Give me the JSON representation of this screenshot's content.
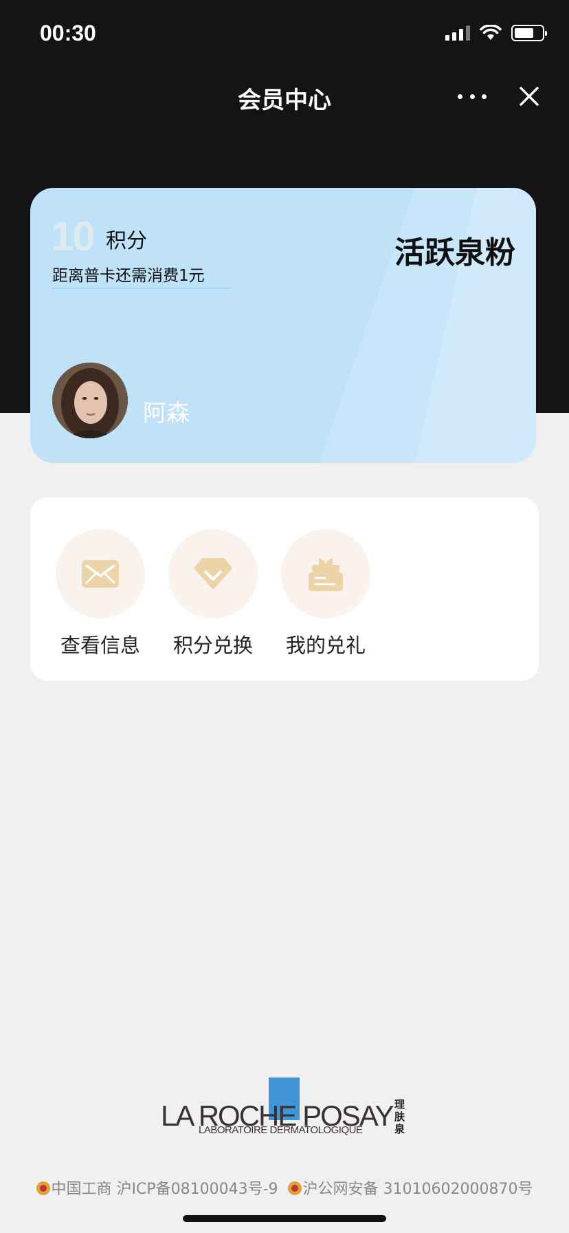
{
  "status_bar": {
    "time": "00:30"
  },
  "nav": {
    "title": "会员中心"
  },
  "card": {
    "points_value": "10",
    "points_unit": "积分",
    "upgrade_tip": "距离普卡还需消费1元",
    "level_name": "活跃泉粉",
    "user_name": "阿森"
  },
  "functions": [
    {
      "label": "查看信息",
      "icon": "envelope-icon"
    },
    {
      "label": "积分兑换",
      "icon": "diamond-icon"
    },
    {
      "label": "我的兑礼",
      "icon": "gift-box-icon"
    }
  ],
  "brand": {
    "logo_main": "LA ROCHE POSAY",
    "logo_sub": "LABORATOIRE DERMATOLOGIQUE",
    "logo_cn": "理肤泉"
  },
  "footer": {
    "icp_text": "中国工商 沪ICP备08100043号-9",
    "police_text": "沪公网安备 31010602000870号"
  },
  "colors": {
    "header_bg": "#141414",
    "card_bg": "#bfe2f9",
    "icon_tan": "#ecd3a8",
    "icon_circle": "#faf2ec",
    "logo_blue": "#3f95d8"
  }
}
